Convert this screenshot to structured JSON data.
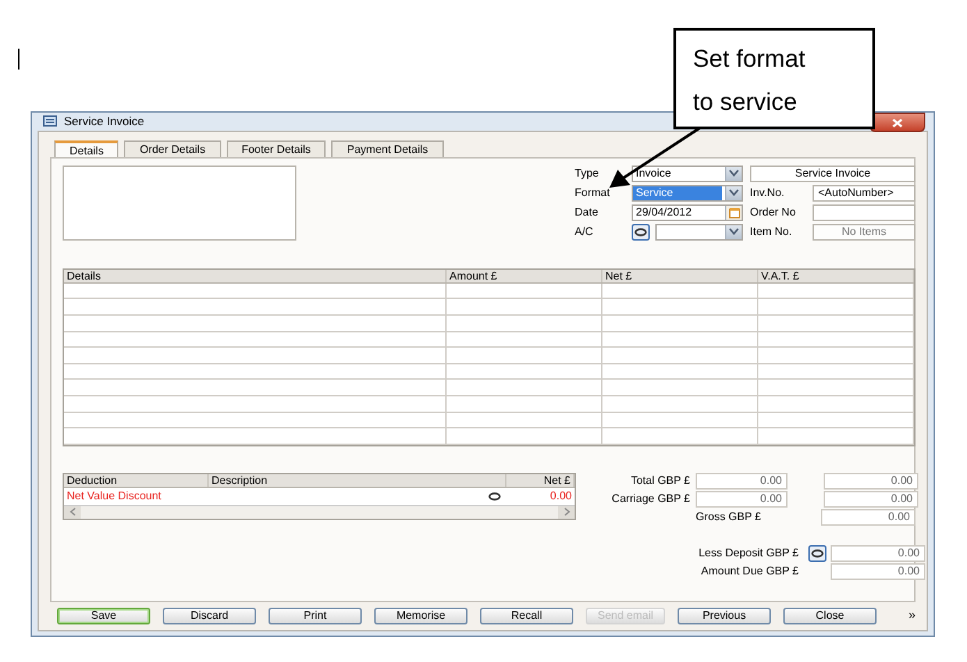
{
  "callout": {
    "text": "Set format to service"
  },
  "window": {
    "title": "Service Invoice"
  },
  "tabs": [
    {
      "label": "Details",
      "selected": true
    },
    {
      "label": "Order Details",
      "selected": false
    },
    {
      "label": "Footer Details",
      "selected": false
    },
    {
      "label": "Payment Details",
      "selected": false
    }
  ],
  "header_fields": [
    {
      "label": "Type",
      "value": "Invoice",
      "kind": "dropdown",
      "highlighted": false
    },
    {
      "label": "Format",
      "value": "Service",
      "kind": "dropdown",
      "highlighted": true
    },
    {
      "label": "Date",
      "value": "29/04/2012",
      "kind": "date",
      "highlighted": false
    },
    {
      "label": "A/C",
      "kind": "lookup",
      "highlighted": false
    }
  ],
  "info_fields": [
    {
      "value": "Service Invoice",
      "kind": "title"
    },
    {
      "label": "Inv.No.",
      "value": "<AutoNumber>",
      "kind": "text"
    },
    {
      "label": "Order No",
      "kind": "text"
    },
    {
      "label": "Item No.",
      "value": "No Items",
      "kind": "readonly"
    }
  ],
  "items_table": {
    "columns": [
      "Details",
      "Amount £",
      "Net £",
      "V.A.T. £"
    ]
  },
  "deductions": {
    "columns": [
      "Deduction",
      "Description",
      "Net £"
    ],
    "rows": [
      {
        "deduction": "Net Value Discount",
        "net": "0.00"
      }
    ]
  },
  "totals": [
    {
      "label": "Total GBP £",
      "values": [
        "0.00",
        "0.00"
      ]
    },
    {
      "label": "Carriage GBP £",
      "values": [
        "0.00",
        "0.00"
      ]
    },
    {
      "label": "Gross GBP £",
      "values": [
        "0.00"
      ]
    }
  ],
  "deposit": [
    {
      "label": "Less Deposit GBP £",
      "value": "0.00",
      "kind": "lookup"
    },
    {
      "label": "Amount Due GBP £",
      "value": "0.00",
      "kind": "plain"
    }
  ],
  "buttons": [
    {
      "label": "Save",
      "default": true,
      "disabled": false
    },
    {
      "label": "Discard",
      "default": false,
      "disabled": false
    },
    {
      "label": "Print",
      "default": false,
      "disabled": false
    },
    {
      "label": "Memorise",
      "default": false,
      "disabled": false
    },
    {
      "label": "Recall",
      "default": false,
      "disabled": false
    },
    {
      "label": "Send email",
      "default": false,
      "disabled": true
    },
    {
      "label": "Previous",
      "default": false,
      "disabled": false
    },
    {
      "label": "Close",
      "default": false,
      "disabled": false
    }
  ],
  "overflow": "»"
}
